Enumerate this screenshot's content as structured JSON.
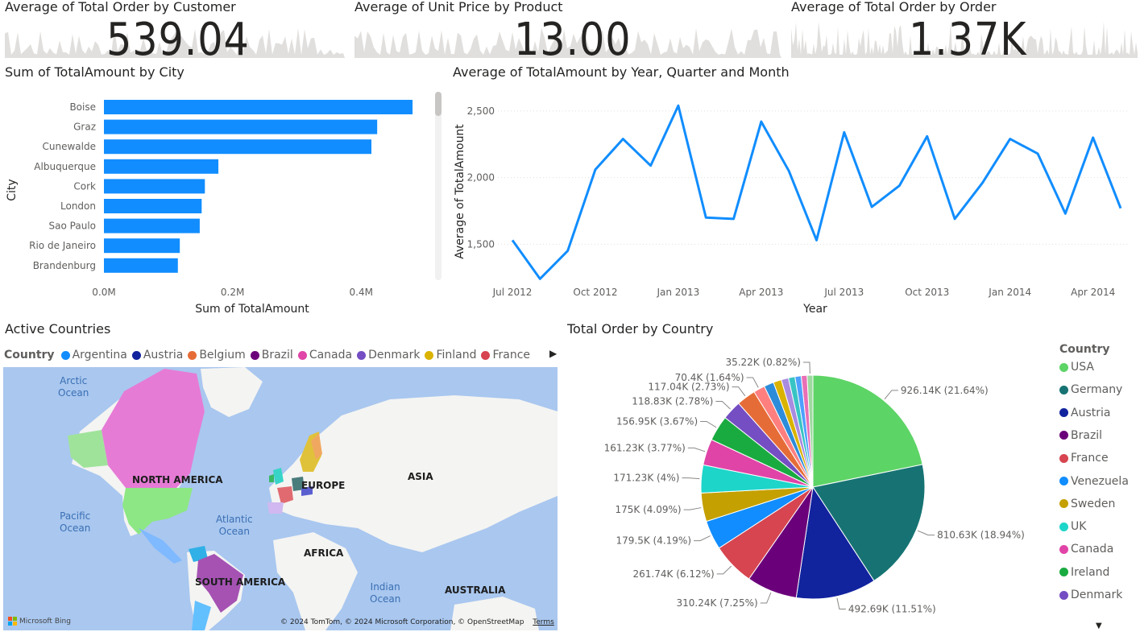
{
  "kpis": [
    {
      "title": "Average of Total Order by Customer",
      "value": "539.04"
    },
    {
      "title": "Average of Unit Price by Product",
      "value": "13.00"
    },
    {
      "title": "Average of Total Order by Order",
      "value": "1.37K"
    }
  ],
  "city_chart": {
    "title": "Sum of TotalAmount by City",
    "chart_data": {
      "type": "bar",
      "categories": [
        "Boise",
        "Graz",
        "Cunewalde",
        "Albuquerque",
        "Cork",
        "London",
        "Sao Paulo",
        "Rio de Janeiro",
        "Brandenburg"
      ],
      "values": [
        480000,
        425000,
        416000,
        178000,
        157000,
        152000,
        149000,
        118000,
        115000
      ],
      "xlabel": "Sum of TotalAmount",
      "ylabel": "City",
      "xticks": [
        "0.0M",
        "0.2M",
        "0.4M"
      ],
      "xlim": [
        0,
        0.52
      ]
    }
  },
  "line_chart": {
    "title": "Average of TotalAmount by Year, Quarter and Month",
    "chart_data": {
      "type": "line",
      "xlabel": "Year",
      "ylabel": "Average of TotalAmount",
      "yticks": [
        "1,500",
        "2,000",
        "2,500"
      ],
      "ylim": [
        1230,
        2620
      ],
      "xticks": [
        "Jul 2012",
        "Oct 2012",
        "Jan 2013",
        "Apr 2013",
        "Jul 2013",
        "Oct 2013",
        "Jan 2014",
        "Apr 2014"
      ],
      "x": [
        "Jul 2012",
        "Aug 2012",
        "Sep 2012",
        "Oct 2012",
        "Nov 2012",
        "Dec 2012",
        "Jan 2013",
        "Feb 2013",
        "Mar 2013",
        "Apr 2013",
        "May 2013",
        "Jun 2013",
        "Jul 2013",
        "Aug 2013",
        "Sep 2013",
        "Oct 2013",
        "Nov 2013",
        "Dec 2013",
        "Jan 2014",
        "Feb 2014",
        "Mar 2014",
        "Apr 2014",
        "May 2014"
      ],
      "values": [
        1530,
        1240,
        1450,
        2060,
        2290,
        2090,
        2540,
        1700,
        1690,
        2420,
        2050,
        1530,
        2340,
        1780,
        1940,
        2310,
        1690,
        1960,
        2290,
        2180,
        1730,
        2300,
        1770
      ]
    }
  },
  "map": {
    "title": "Active Countries",
    "legend_title": "Country",
    "legend": [
      {
        "name": "Argentina",
        "color": "#118DFF"
      },
      {
        "name": "Austria",
        "color": "#12239E"
      },
      {
        "name": "Belgium",
        "color": "#E66C37"
      },
      {
        "name": "Brazil",
        "color": "#6B007B"
      },
      {
        "name": "Canada",
        "color": "#E044A7"
      },
      {
        "name": "Denmark",
        "color": "#744EC2"
      },
      {
        "name": "Finland",
        "color": "#D9B300"
      },
      {
        "name": "France",
        "color": "#D64550"
      }
    ],
    "labels": {
      "arctic": "Arctic\nOcean",
      "pacific": "Pacific\nOcean",
      "atlantic": "Atlantic\nOcean",
      "indian": "Indian\nOcean",
      "north_america": "NORTH AMERICA",
      "south_america": "SOUTH AMERICA",
      "europe": "EUROPE",
      "asia": "ASIA",
      "africa": "AFRICA",
      "australia": "AUSTRALIA"
    },
    "bing": "Microsoft Bing",
    "copyright": "© 2024 TomTom, © 2024 Microsoft Corporation, © OpenStreetMap",
    "terms": "Terms"
  },
  "pie": {
    "title": "Total Order by Country",
    "legend_title": "Country",
    "chart_data": {
      "type": "pie",
      "slices": [
        {
          "name": "USA",
          "value": 926.14,
          "label": "926.14K (21.64%)",
          "color": "#5DD466"
        },
        {
          "name": "Germany",
          "value": 810.63,
          "label": "810.63K (18.94%)",
          "color": "#177373"
        },
        {
          "name": "Austria",
          "value": 492.69,
          "label": "492.69K (11.51%)",
          "color": "#12239E"
        },
        {
          "name": "Brazil",
          "value": 310.24,
          "label": "310.24K (7.25%)",
          "color": "#6B007B"
        },
        {
          "name": "France",
          "value": 261.74,
          "label": "261.74K (6.12%)",
          "color": "#D64550"
        },
        {
          "name": "Venezuela",
          "value": 179.5,
          "label": "179.5K (4.19%)",
          "color": "#118DFF"
        },
        {
          "name": "Sweden",
          "value": 175,
          "label": "175K (4.09%)",
          "color": "#C4A000"
        },
        {
          "name": "UK",
          "value": 171.23,
          "label": "171.23K (4%)",
          "color": "#1ED5C9"
        },
        {
          "name": "Canada",
          "value": 161.23,
          "label": "161.23K (3.77%)",
          "color": "#E044A7"
        },
        {
          "name": "Ireland",
          "value": 156.95,
          "label": "156.95K (3.67%)",
          "color": "#1AAB40"
        },
        {
          "name": "Denmark",
          "value": 118.83,
          "label": "118.83K (2.78%)",
          "color": "#744EC2"
        },
        {
          "name": "",
          "value": 117.04,
          "label": "117.04K (2.73%)",
          "color": "#E66C37"
        },
        {
          "name": "",
          "value": 70.4,
          "label": "70.4K (1.64%)",
          "color": "#FF7F7F"
        },
        {
          "name": "",
          "value": 60,
          "label": "",
          "color": "#2C8CD9"
        },
        {
          "name": "",
          "value": 50,
          "label": "",
          "color": "#D9B300"
        },
        {
          "name": "",
          "value": 45,
          "label": "",
          "color": "#A98CE0"
        },
        {
          "name": "",
          "value": 40,
          "label": "",
          "color": "#38C4C4"
        },
        {
          "name": "",
          "value": 38,
          "label": "",
          "color": "#4DA0FF"
        },
        {
          "name": "",
          "value": 36,
          "label": "",
          "color": "#E86FB5"
        },
        {
          "name": "",
          "value": 35.22,
          "label": "35.22K (0.82%)",
          "color": "#9ED9A0"
        }
      ]
    }
  }
}
